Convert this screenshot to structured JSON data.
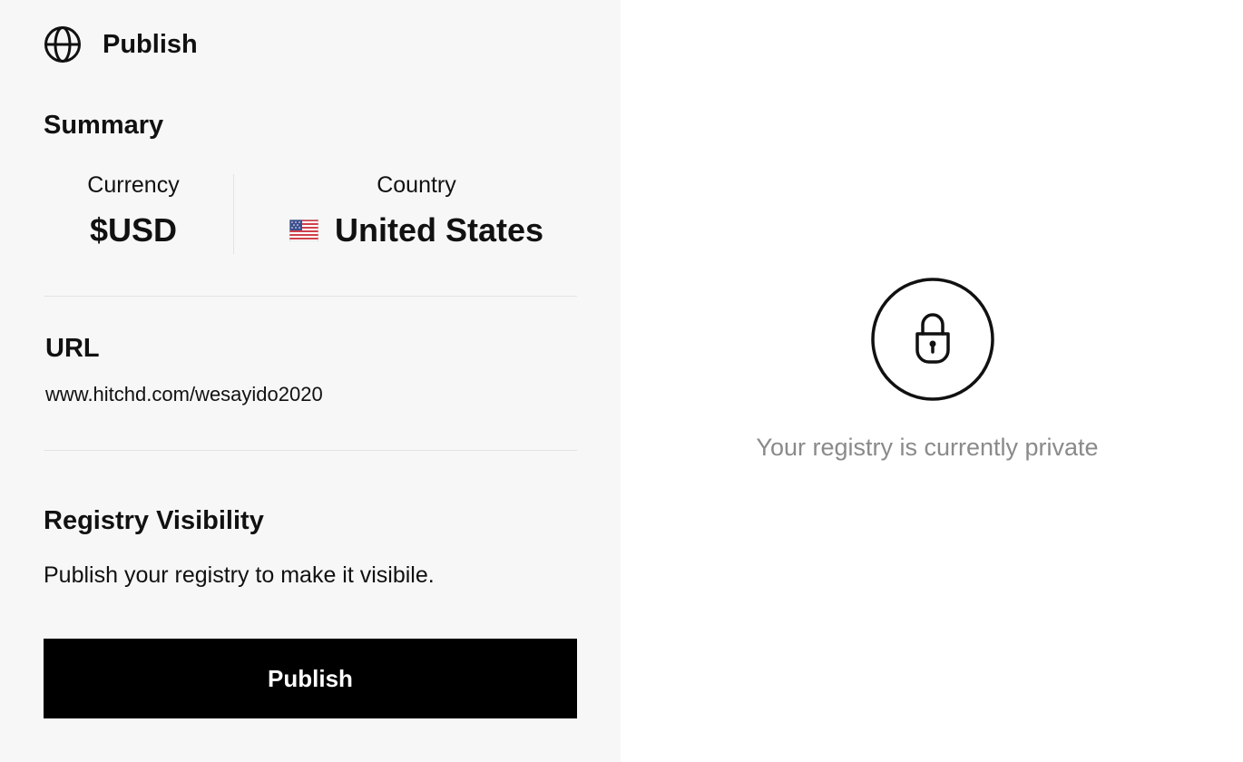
{
  "header": {
    "title": "Publish",
    "icon": "globe-icon"
  },
  "summary": {
    "title": "Summary",
    "currency": {
      "label": "Currency",
      "value": "$USD"
    },
    "country": {
      "label": "Country",
      "value": "United States",
      "flag_icon": "us-flag-icon"
    }
  },
  "url": {
    "title": "URL",
    "value": "www.hitchd.com/wesayido2020"
  },
  "visibility": {
    "title": "Registry Visibility",
    "description": "Publish your registry to make it visibile.",
    "button_label": "Publish"
  },
  "status": {
    "icon": "lock-icon",
    "message": "Your registry is currently private"
  },
  "colors": {
    "sidebar_bg": "#f7f7f7",
    "button_bg": "#000000",
    "button_text": "#ffffff",
    "muted_text": "#8a8a8a"
  }
}
